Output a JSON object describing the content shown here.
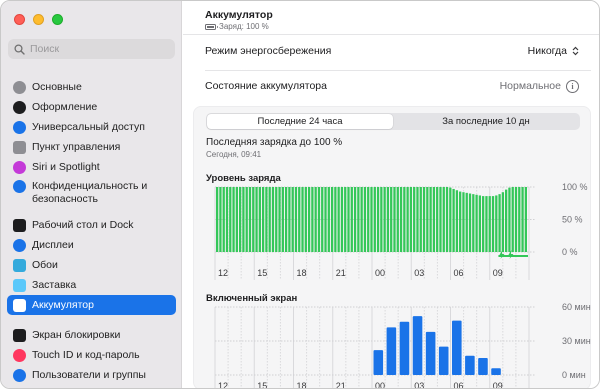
{
  "colors": {
    "accent": "#1a73e8",
    "battery_bar": "#34c759",
    "screen_bar": "#1a73e8"
  },
  "sidebar": {
    "search": {
      "placeholder": "Поиск",
      "icon": "magnifying-glass-icon"
    },
    "groups": [
      {
        "items": [
          {
            "label": "Основные",
            "icon": "gear-icon",
            "color": "#8e8e93"
          },
          {
            "label": "Оформление",
            "icon": "appearance-icon",
            "color": "#1d1d1f"
          },
          {
            "label": "Универсальный доступ",
            "icon": "accessibility-icon",
            "color": "#1a73e8"
          },
          {
            "label": "Пункт управления",
            "icon": "control-center-icon",
            "color": "#8e8e93"
          },
          {
            "label": "Siri и Spotlight",
            "icon": "siri-icon",
            "color": "#c43ad8"
          },
          {
            "label": "Конфиденциальность и безопасность",
            "icon": "privacy-hand-icon",
            "color": "#1a73e8"
          }
        ]
      },
      {
        "items": [
          {
            "label": "Рабочий стол и Dock",
            "icon": "dock-icon",
            "color": "#1d1d1f"
          },
          {
            "label": "Дисплеи",
            "icon": "display-brightness-icon",
            "color": "#1a73e8"
          },
          {
            "label": "Обои",
            "icon": "wallpaper-icon",
            "color": "#34aadc"
          },
          {
            "label": "Заставка",
            "icon": "screensaver-icon",
            "color": "#5ac8fa"
          },
          {
            "label": "Аккумулятор",
            "icon": "battery-icon",
            "color": "#34c759",
            "active": true
          }
        ]
      },
      {
        "items": [
          {
            "label": "Экран блокировки",
            "icon": "lock-screen-icon",
            "color": "#1d1d1f"
          },
          {
            "label": "Touch ID и код-пароль",
            "icon": "fingerprint-icon",
            "color": "#ff375f"
          },
          {
            "label": "Пользователи и группы",
            "icon": "users-icon",
            "color": "#1a73e8"
          }
        ]
      }
    ]
  },
  "header": {
    "title": "Аккумулятор",
    "subtitle": "Заряд: 100 %"
  },
  "settings": {
    "power_mode_label": "Режим энергосбережения",
    "power_mode_value": "Никогда",
    "battery_health_label": "Состояние аккумулятора",
    "battery_health_value": "Нормальное"
  },
  "tabs": [
    "Последние 24 часа",
    "За последние 10 дн"
  ],
  "selected_tab": 0,
  "last_charge": {
    "label": "Последняя зарядка до 100 %",
    "time": "Сегодня, 09:41"
  },
  "chart_data": [
    {
      "type": "bar",
      "title": "Уровень заряда",
      "x_tick_labels": [
        "12",
        "15",
        "18",
        "21",
        "00",
        "03",
        "06",
        "09"
      ],
      "y_tick_labels": [
        "100 %",
        "50 %",
        "0 %"
      ],
      "ylim": [
        0,
        100
      ],
      "values": [
        100,
        100,
        100,
        100,
        100,
        100,
        100,
        100,
        100,
        100,
        100,
        100,
        100,
        100,
        100,
        100,
        100,
        100,
        100,
        100,
        100,
        100,
        100,
        100,
        100,
        100,
        100,
        100,
        100,
        100,
        100,
        100,
        100,
        100,
        100,
        100,
        100,
        100,
        100,
        100,
        100,
        100,
        100,
        100,
        100,
        100,
        100,
        100,
        100,
        100,
        100,
        100,
        100,
        100,
        100,
        100,
        100,
        100,
        100,
        100,
        100,
        100,
        100,
        100,
        100,
        100,
        100,
        100,
        100,
        100,
        100,
        99,
        97,
        95,
        93,
        92,
        91,
        90,
        89,
        88,
        87,
        86,
        86,
        86,
        86,
        87,
        89,
        92,
        96,
        99,
        100,
        100,
        100,
        100,
        100
      ],
      "charging_indicator_hours": [
        "06",
        "09"
      ],
      "grid": true
    },
    {
      "type": "bar",
      "title": "Включенный экран",
      "x_tick_labels": [
        "12",
        "15",
        "18",
        "21",
        "00",
        "03",
        "06",
        "09"
      ],
      "y_tick_labels": [
        "60 мин",
        "30 мин",
        "0 мин"
      ],
      "ylim": [
        0,
        60
      ],
      "categories": [
        "00",
        "01",
        "02",
        "03",
        "04",
        "05",
        "06",
        "07",
        "08",
        "09"
      ],
      "values": [
        22,
        42,
        47,
        52,
        38,
        25,
        48,
        17,
        15,
        6
      ],
      "grid": true
    }
  ]
}
